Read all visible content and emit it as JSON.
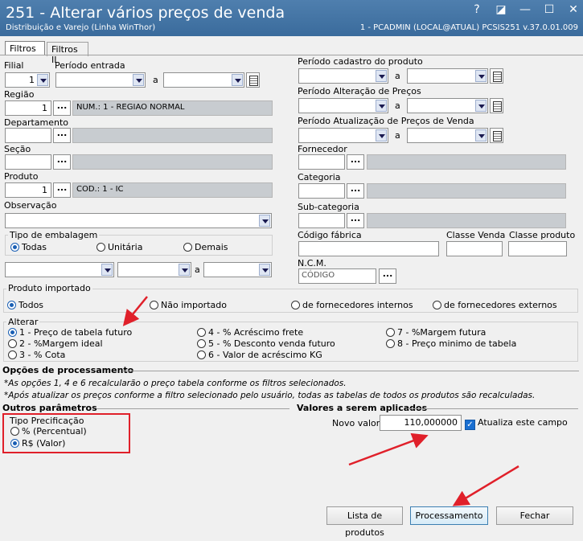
{
  "window": {
    "title": "251 - Alterar vários preços de venda",
    "subtitle": "Distribuição e Varejo (Linha WinThor)",
    "session": "1 - PCADMIN (LOCAL@ATUAL)   PCSIS251  v.37.0.01.009",
    "controls": [
      "?",
      "◪",
      "—",
      "☐",
      "✕"
    ]
  },
  "tabs": [
    "Filtros",
    "Filtros II"
  ],
  "filters": {
    "filial_label": "Filial",
    "filial_value": "1",
    "periodo_entrada_label": "Período entrada",
    "a": "a",
    "regiao_label": "Região",
    "regiao_code": "1",
    "regiao_desc": "NUM.: 1 - REGIAO NORMAL",
    "departamento_label": "Departamento",
    "secao_label": "Seção",
    "produto_label": "Produto",
    "produto_code": "1",
    "produto_desc": "COD.: 1 - IC",
    "observacao_label": "Observação",
    "tipo_embalagem_label": "Tipo de embalagem",
    "embalagem_options": [
      "Todas",
      "Unitária",
      "Demais"
    ],
    "embalagem_selected": "Todas",
    "periodo_cadastro_label": "Período cadastro do produto",
    "periodo_alteracao_label": "Período Alteração de Preços",
    "periodo_atualizacao_label": "Período Atualização de Preços de Venda",
    "fornecedor_label": "Fornecedor",
    "categoria_label": "Categoria",
    "subcategoria_label": "Sub-categoria",
    "codigo_fabrica_label": "Código fábrica",
    "classe_venda_label": "Classe Venda",
    "classe_produto_label": "Classe produto",
    "ncm_label": "N.C.M.",
    "ncm_placeholder": "CÓDIGO",
    "dots": "..."
  },
  "produto_importado": {
    "label": "Produto importado",
    "options": [
      "Todos",
      "Não importado",
      "de fornecedores internos",
      "de fornecedores externos"
    ],
    "selected": "Todos"
  },
  "alterar": {
    "label": "Alterar",
    "options": [
      "1 - Preço de tabela futuro",
      "2 - %Margem ideal",
      "3 - % Cota",
      "4 - % Acréscimo frete",
      "5 - % Desconto venda futuro",
      "6 - Valor de acréscimo KG",
      "7 - %Margem futura",
      "8 - Preço minimo de tabela"
    ],
    "selected": "1 - Preço de tabela futuro"
  },
  "opcoes": {
    "label": "Opções de processamento",
    "note1": "*As opções 1, 4 e 6 recalcularão o preço tabela conforme os filtros selecionados.",
    "note2": "*Após atualizar os preços conforme a filtro selecionado pelo usuário, todas as tabelas de todos os produtos são recalculadas."
  },
  "outros": {
    "label": "Outros parâmetros",
    "tipo_label": "Tipo Precificação",
    "options": [
      "% (Percentual)",
      "R$ (Valor)"
    ],
    "selected": "R$ (Valor)"
  },
  "valores": {
    "label": "Valores a serem aplicados",
    "novo_valor_label": "Novo valor:",
    "novo_valor": "110,000000",
    "atualiza_label": "Atualiza este campo",
    "atualiza_checked": true
  },
  "buttons": {
    "lista": "Lista de produtos",
    "processamento": "Processamento",
    "fechar": "Fechar"
  },
  "colors": {
    "titlebar": "#3d6e9f",
    "highlight": "#e0202a",
    "accent": "#1a5fb4"
  }
}
